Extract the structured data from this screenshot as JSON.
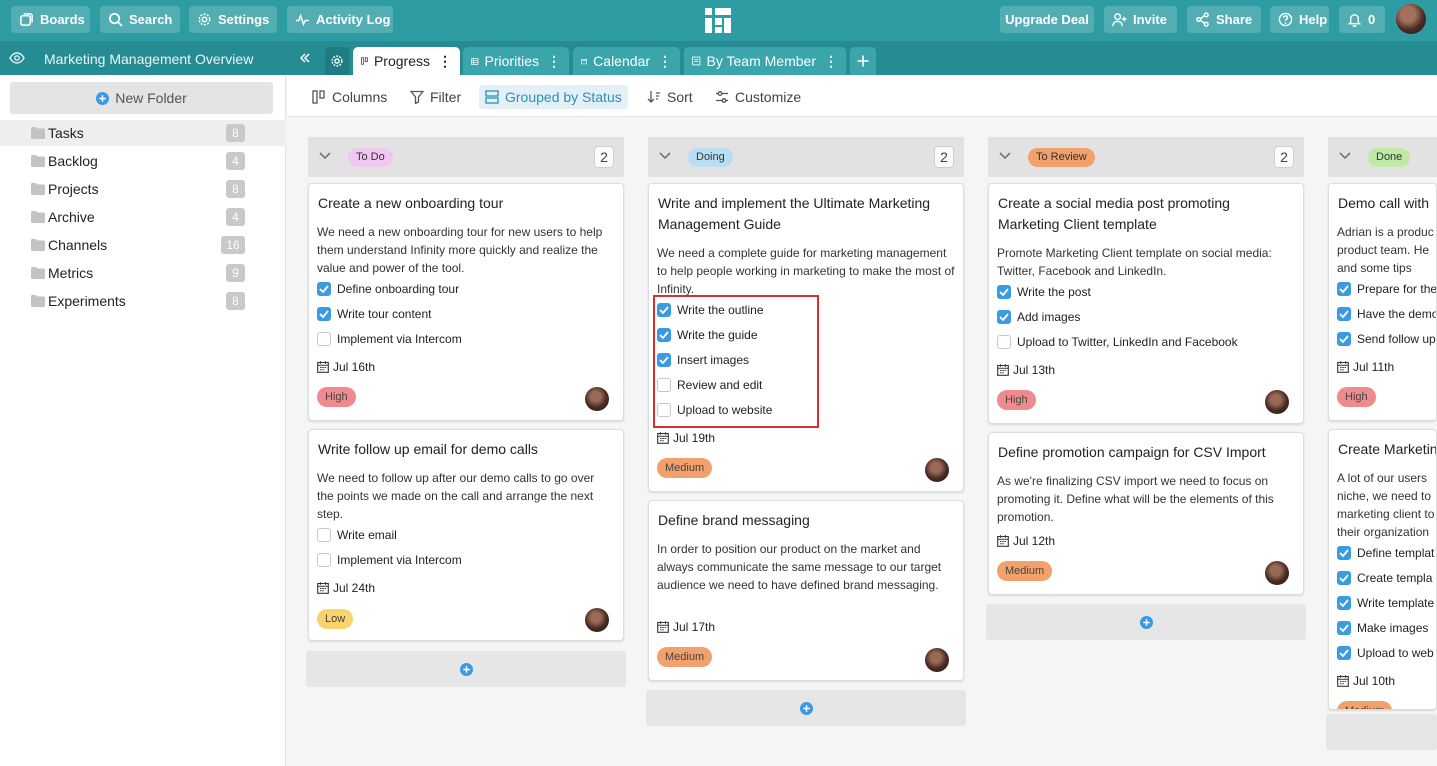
{
  "topbar": {
    "boards_label": "Boards",
    "search_label": "Search",
    "settings_label": "Settings",
    "activity_label": "Activity Log",
    "upgrade_label": "Upgrade Deal",
    "invite_label": "Invite",
    "share_label": "Share",
    "help_label": "Help",
    "notifications_count": "0"
  },
  "folder": {
    "title": "Marketing Management Overview"
  },
  "tabs": [
    {
      "label": "Progress",
      "active": true
    },
    {
      "label": "Priorities"
    },
    {
      "label": "Calendar"
    },
    {
      "label": "By Team Member"
    }
  ],
  "sidebar": {
    "new_folder_label": "New Folder",
    "items": [
      {
        "label": "Tasks",
        "count": "8",
        "selected": true
      },
      {
        "label": "Backlog",
        "count": "4"
      },
      {
        "label": "Projects",
        "count": "8"
      },
      {
        "label": "Archive",
        "count": "4"
      },
      {
        "label": "Channels",
        "count": "16"
      },
      {
        "label": "Metrics",
        "count": "9"
      },
      {
        "label": "Experiments",
        "count": "8"
      }
    ]
  },
  "toolbar": {
    "columns_label": "Columns",
    "filter_label": "Filter",
    "grouped_label": "Grouped by Status",
    "sort_label": "Sort",
    "customize_label": "Customize"
  },
  "colors": {
    "teal_primary": "#2d9da3",
    "todo": "#f1c6f0",
    "doing": "#b9def3",
    "review": "#f2a06c",
    "done": "#bfe9a7",
    "check_blue": "#3a9be0"
  },
  "board": {
    "columns": [
      {
        "status": "To Do",
        "count": "2",
        "cards": [
          {
            "title": "Create a new onboarding tour",
            "desc": "We need a new onboarding tour for new users to help them understand Infinity more quickly and realize the value and power of the tool.",
            "checklist": [
              {
                "label": "Define onboarding tour",
                "checked": true
              },
              {
                "label": "Write tour content",
                "checked": true
              },
              {
                "label": "Implement via Intercom",
                "checked": false
              }
            ],
            "date": "Jul 16th",
            "priority": "High"
          },
          {
            "title": "Write follow up email for demo calls",
            "desc": "We need to follow up after our demo calls to go over the points we made on the call and arrange the next step.",
            "checklist": [
              {
                "label": "Write email",
                "checked": false
              },
              {
                "label": "Implement via Intercom",
                "checked": false
              }
            ],
            "date": "Jul 24th",
            "priority": "Low"
          }
        ]
      },
      {
        "status": "Doing",
        "count": "2",
        "cards": [
          {
            "title": "Write and implement the Ultimate Marketing Management Guide",
            "desc": "We need a complete guide for marketing management to help people working in marketing to make the most of Infinity.",
            "checklist": [
              {
                "label": "Write the outline",
                "checked": true
              },
              {
                "label": "Write the guide",
                "checked": true
              },
              {
                "label": "Insert images",
                "checked": true
              },
              {
                "label": "Review and edit",
                "checked": false
              },
              {
                "label": "Upload to website",
                "checked": false
              }
            ],
            "date": "Jul 19th",
            "priority": "Medium"
          },
          {
            "title": "Define brand messaging",
            "desc": "In order to position our product on the market and always communicate the same message to our target audience we need to have defined brand messaging.",
            "checklist": [],
            "date": "Jul 17th",
            "priority": "Medium"
          }
        ]
      },
      {
        "status": "To Review",
        "count": "2",
        "cards": [
          {
            "title": "Create a social media post promoting Marketing Client template",
            "desc": "Promote Marketing Client template on social media: Twitter, Facebook and LinkedIn.",
            "checklist": [
              {
                "label": "Write the post",
                "checked": true
              },
              {
                "label": "Add images",
                "checked": true
              },
              {
                "label": "Upload to Twitter, LinkedIn and Facebook",
                "checked": false
              }
            ],
            "date": "Jul 13th",
            "priority": "High"
          },
          {
            "title": "Define promotion campaign for CSV Import",
            "desc": "As we're finalizing CSV import we need to focus on promoting it. Define what will be the elements of this promotion.",
            "checklist": [],
            "date": "Jul 12th",
            "priority": "Medium"
          }
        ]
      },
      {
        "status": "Done",
        "cards": [
          {
            "title": "Demo call with",
            "desc": "Adrian is a produc product team. He and some tips how",
            "checklist": [
              {
                "label": "Prepare for the",
                "checked": true
              },
              {
                "label": "Have the demo",
                "checked": true
              },
              {
                "label": "Send follow up",
                "checked": true
              }
            ],
            "date": "Jul 11th",
            "priority": "High"
          },
          {
            "title": "Create Marketin",
            "desc": "A lot of our users niche, we need to marketing client to their organization",
            "checklist": [
              {
                "label": "Define templat",
                "checked": true
              },
              {
                "label": "Create templa",
                "checked": true
              },
              {
                "label": "Write template",
                "checked": true
              },
              {
                "label": "Make images",
                "checked": true
              },
              {
                "label": "Upload to web",
                "checked": true
              }
            ],
            "date": "Jul 10th",
            "priority": "Medium"
          }
        ]
      }
    ]
  }
}
